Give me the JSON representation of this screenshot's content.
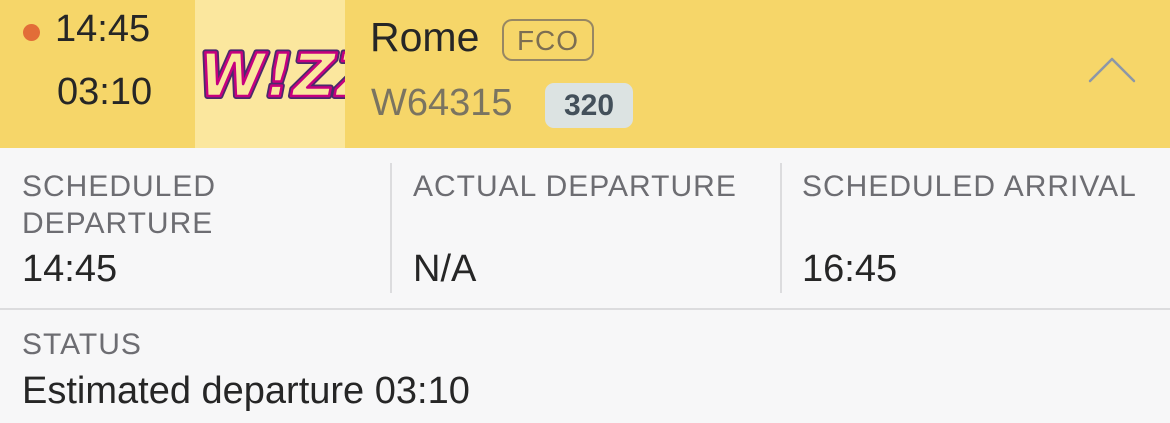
{
  "flight": {
    "scheduled_time": "14:45",
    "estimated_time": "03:10",
    "airline_logo_text": "WIZZ",
    "destination_city": "Rome",
    "destination_code": "FCO",
    "flight_number": "W64315",
    "aircraft_type": "320",
    "status_dot_color": "#e26d38",
    "expand_icon": "chevron-up-icon"
  },
  "details": {
    "scheduled_departure_label": "SCHEDULED DEPARTURE",
    "scheduled_departure_value": "14:45",
    "actual_departure_label": "ACTUAL DEPARTURE",
    "actual_departure_value": "N/A",
    "scheduled_arrival_label": "SCHEDULED ARRIVAL",
    "scheduled_arrival_value": "16:45"
  },
  "status": {
    "label": "STATUS",
    "value": "Estimated departure 03:10"
  },
  "colors": {
    "header_bg": "#f6d669",
    "logo_bg": "#fbe79e",
    "wizz_magenta": "#c6007e",
    "wizz_purple": "#4a2a6b"
  }
}
